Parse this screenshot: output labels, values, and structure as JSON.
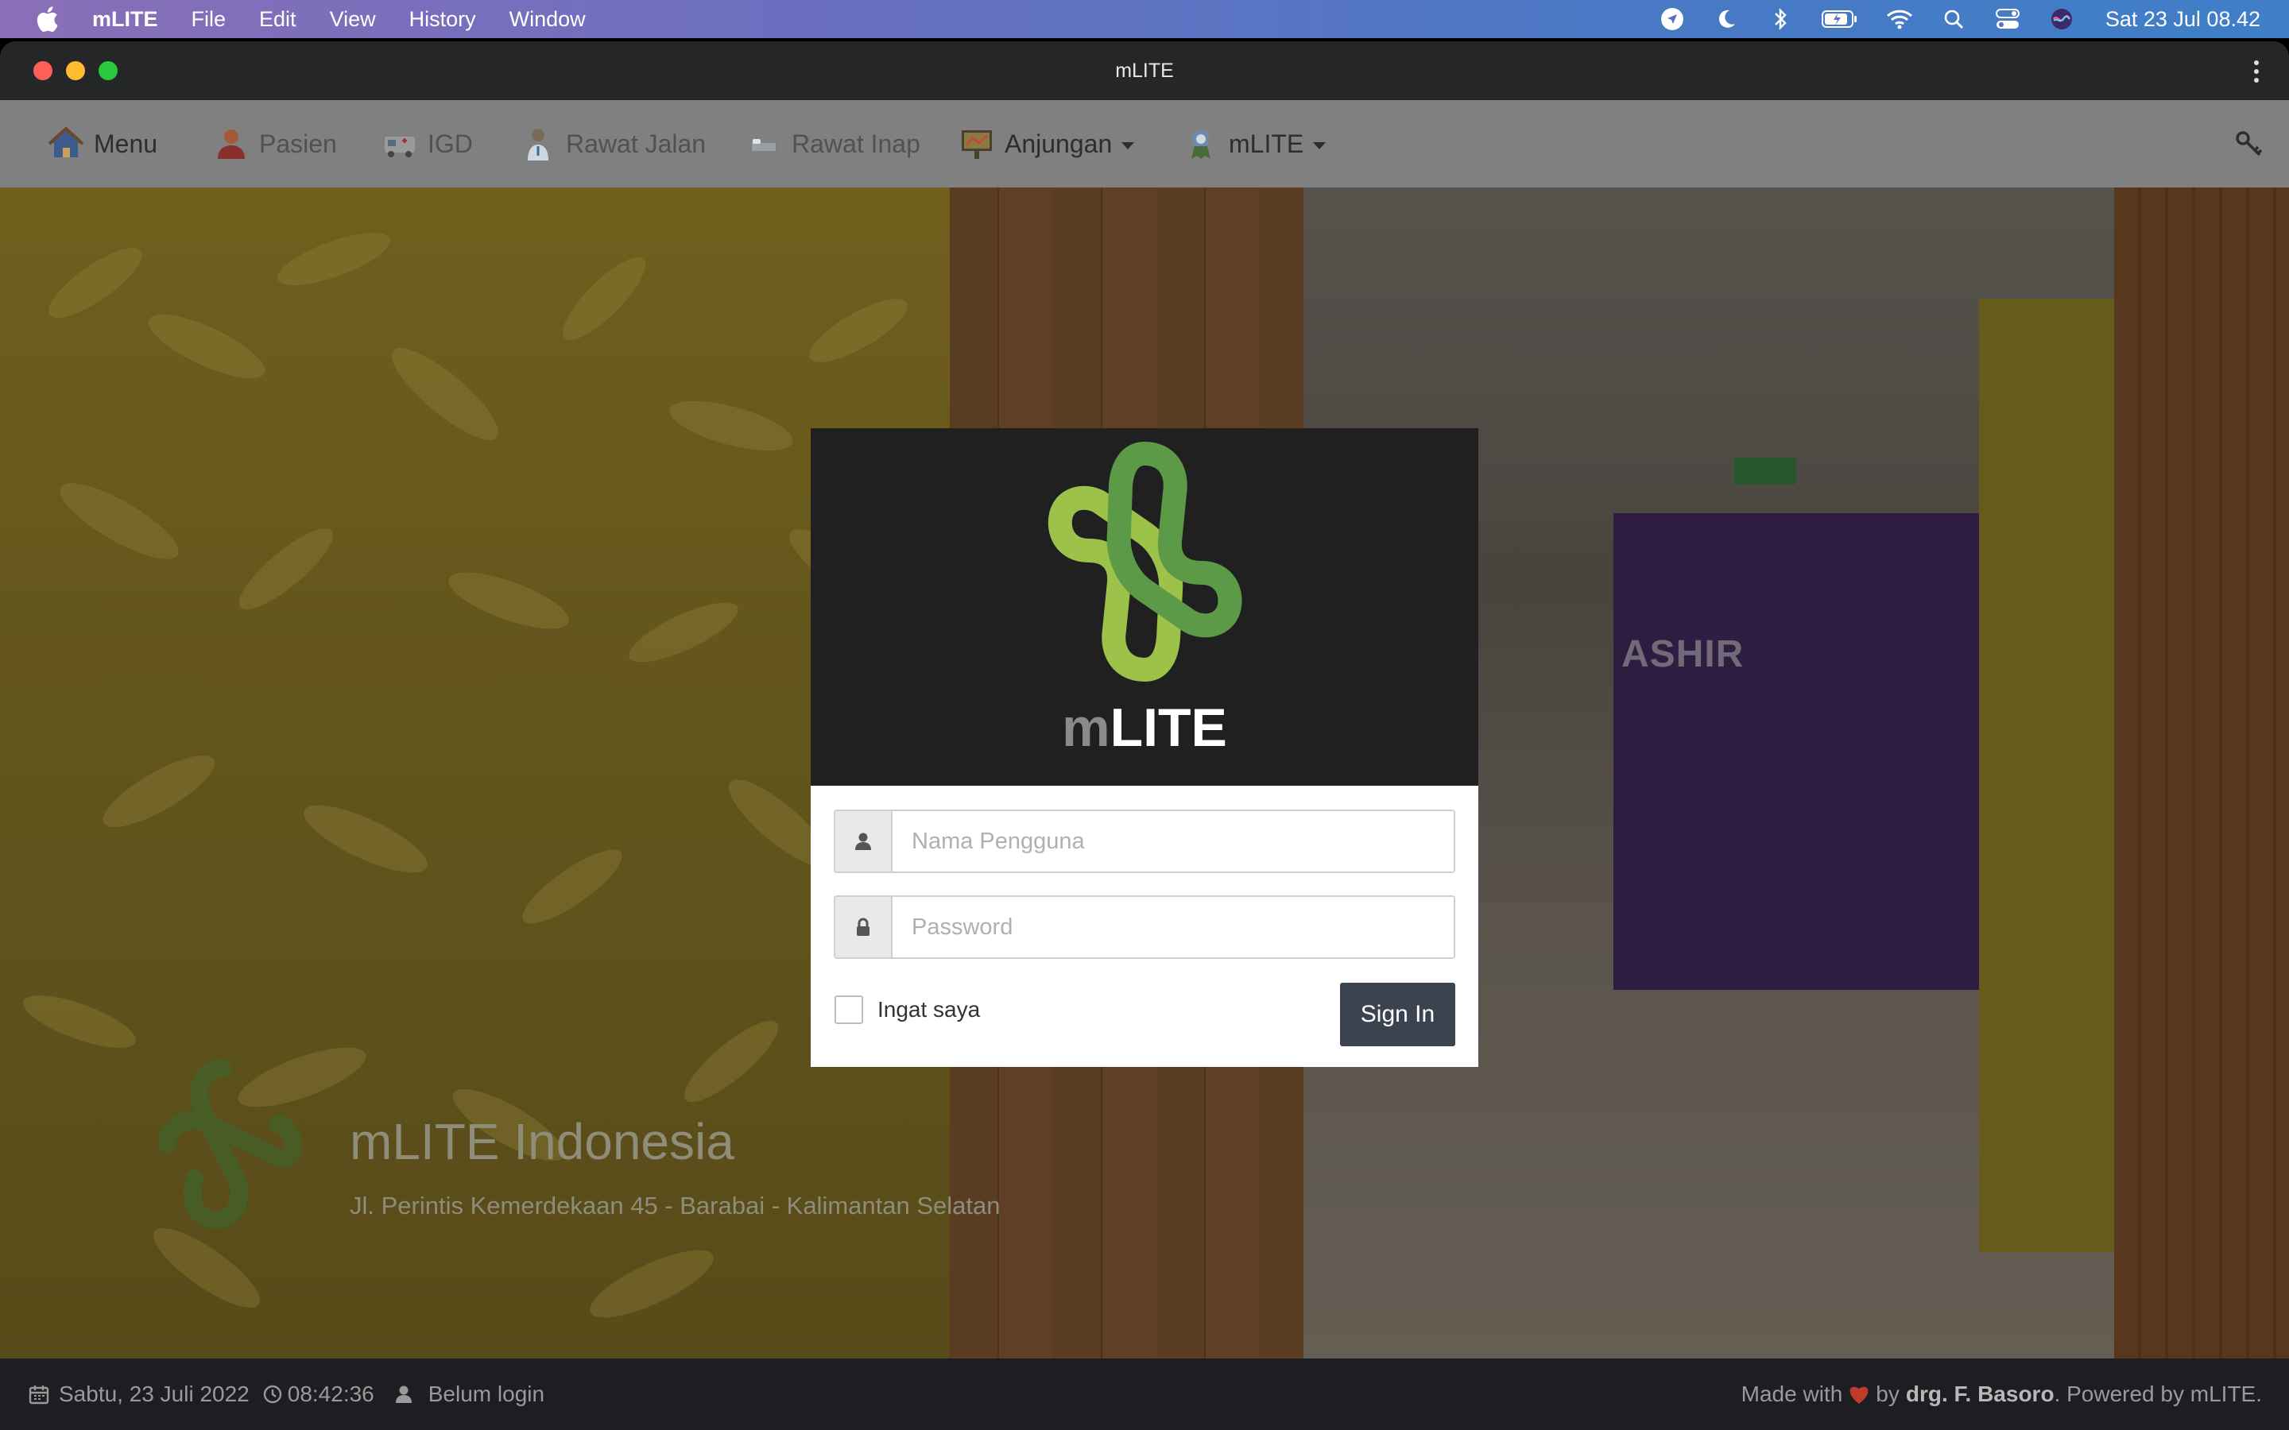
{
  "menubar": {
    "app_name": "mLITE",
    "items": [
      "File",
      "Edit",
      "View",
      "History",
      "Window"
    ],
    "clock": "Sat 23 Jul  08.42",
    "status_icons": [
      "location-icon",
      "moon-icon",
      "bluetooth-icon",
      "battery-icon",
      "wifi-icon",
      "search-icon",
      "control-center-icon",
      "siri-icon"
    ]
  },
  "window": {
    "title": "mLITE"
  },
  "navbar": {
    "items": [
      {
        "label": "Menu",
        "icon": "house-icon"
      },
      {
        "label": "Pasien",
        "icon": "patient-icon"
      },
      {
        "label": "IGD",
        "icon": "ambulance-icon"
      },
      {
        "label": "Rawat Jalan",
        "icon": "doctor-icon"
      },
      {
        "label": "Rawat Inap",
        "icon": "bed-icon"
      },
      {
        "label": "Anjungan",
        "icon": "kiosk-icon"
      },
      {
        "label": "mLITE",
        "icon": "badge-icon"
      }
    ]
  },
  "background": {
    "sign_text": "ASHIR"
  },
  "brand": {
    "title": "mLITE Indonesia",
    "address": "Jl. Perintis Kemerdekaan 45 - Barabai - Kalimantan Selatan"
  },
  "login": {
    "wordmark_m": "m",
    "wordmark_lite": "LITE",
    "username_placeholder": "Nama Pengguna",
    "password_placeholder": "Password",
    "remember_label": "Ingat saya",
    "signin_label": "Sign In"
  },
  "footer": {
    "date": "Sabtu, 23 Juli 2022",
    "time": "08:42:36",
    "login_status": "Belum login",
    "made_with": "Made with",
    "by": "by",
    "author": "drg. F. Basoro",
    "powered": ". Powered by mLITE."
  },
  "colors": {
    "logo_dark_green": "#5d9a48",
    "logo_light_green": "#9cc24a",
    "signin_button": "#3c4350",
    "footer_bg": "#1c1e22"
  }
}
